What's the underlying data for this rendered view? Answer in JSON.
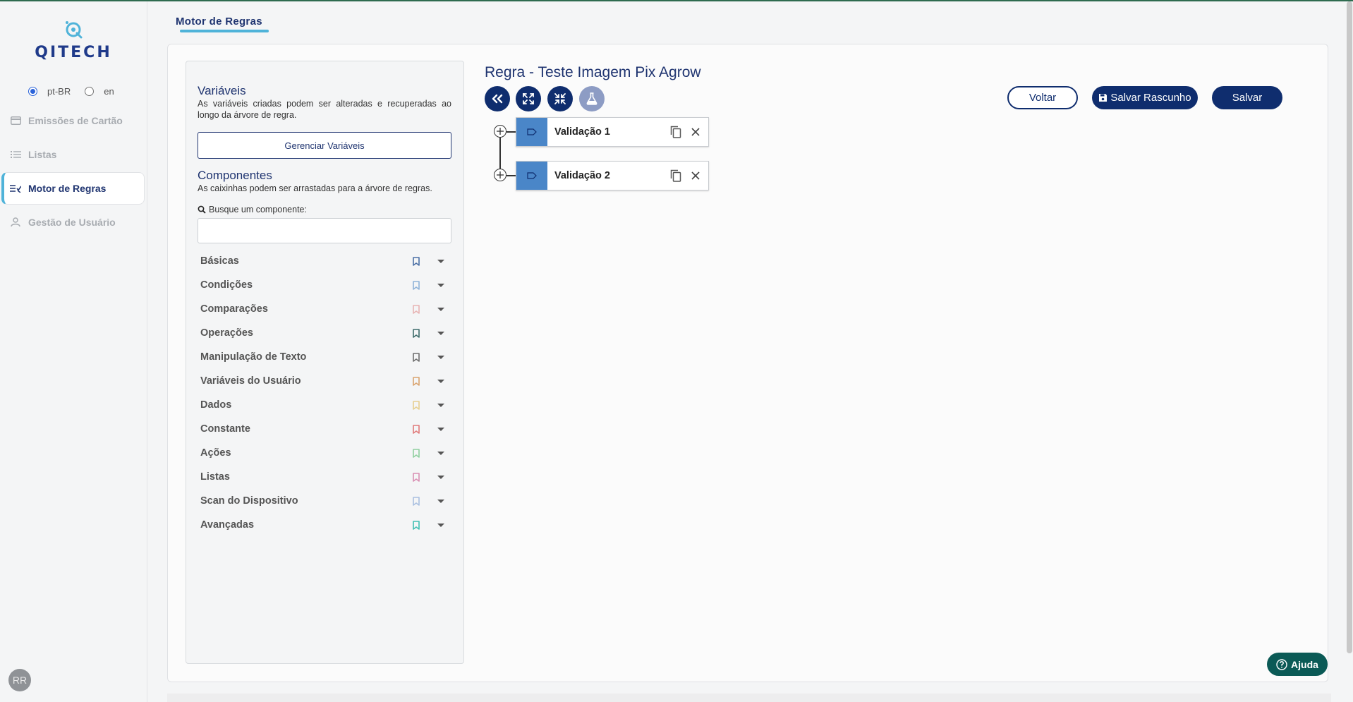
{
  "app": {
    "logo_text": "QITECH",
    "page_tab": "Motor de Regras"
  },
  "language": {
    "options": [
      "pt-BR",
      "en"
    ],
    "selected": "pt-BR"
  },
  "sidebar": {
    "items": [
      {
        "label": "Emissões de Cartão",
        "icon": "credit-card-icon",
        "active": false
      },
      {
        "label": "Listas",
        "icon": "list-icon",
        "active": false
      },
      {
        "label": "Motor de Regras",
        "icon": "rules-icon",
        "active": true
      },
      {
        "label": "Gestão de Usuário",
        "icon": "user-icon",
        "active": false
      }
    ],
    "avatar_initials": "RR"
  },
  "panel": {
    "variables_title": "Variáveis",
    "variables_desc": "As variáveis criadas podem ser alteradas e recuperadas ao longo da árvore de regra.",
    "manage_button": "Gerenciar Variáveis",
    "components_title": "Componentes",
    "components_desc": "As caixinhas podem ser arrastadas para a árvore de regras.",
    "search_label": "Busque um componente:",
    "search_value": "",
    "components": [
      {
        "label": "Básicas",
        "color": "#4a6fa5"
      },
      {
        "label": "Condições",
        "color": "#8fb3d9"
      },
      {
        "label": "Comparações",
        "color": "#e8b4b4"
      },
      {
        "label": "Operações",
        "color": "#3d6b6b"
      },
      {
        "label": "Manipulação de Texto",
        "color": "#6e6e6e"
      },
      {
        "label": "Variáveis do Usuário",
        "color": "#d9a36e"
      },
      {
        "label": "Dados",
        "color": "#e6cf8f"
      },
      {
        "label": "Constante",
        "color": "#e07a7a"
      },
      {
        "label": "Ações",
        "color": "#8fcf9f"
      },
      {
        "label": "Listas",
        "color": "#d98fb3"
      },
      {
        "label": "Scan do Dispositivo",
        "color": "#a9bfe0"
      },
      {
        "label": "Avançadas",
        "color": "#3fbfb3"
      }
    ]
  },
  "editor": {
    "rule_title": "Regra - Teste Imagem Pix Agrow",
    "tools": [
      "collapse-left-icon",
      "expand-icon",
      "compress-icon",
      "flask-icon"
    ],
    "back_button": "Voltar",
    "draft_button": "Salvar Rascunho",
    "save_button": "Salvar",
    "nodes": [
      {
        "label": "Validação 1"
      },
      {
        "label": "Validação 2"
      }
    ]
  },
  "help": {
    "label": "Ajuda"
  },
  "colors": {
    "primary": "#0f2d6e",
    "accent": "#4fb3d9",
    "node_tag": "#4a86c8",
    "help": "#0b5a56"
  }
}
